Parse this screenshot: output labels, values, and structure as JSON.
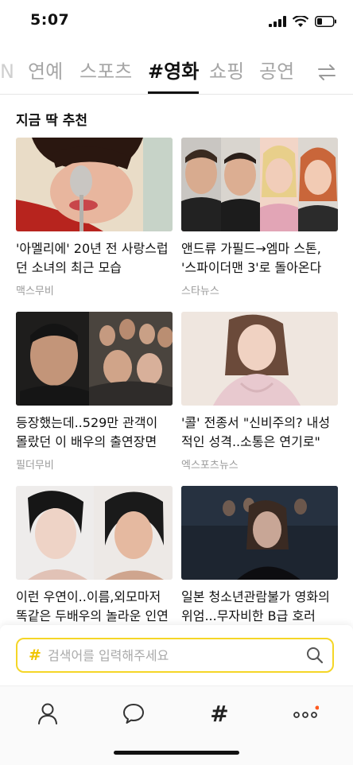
{
  "status_bar": {
    "time": "5:07"
  },
  "tabs": [
    {
      "label": "N"
    },
    {
      "label": "연예"
    },
    {
      "label": "스포츠"
    },
    {
      "label": "#영화",
      "active": true
    },
    {
      "label": "쇼핑"
    },
    {
      "label": "공연"
    }
  ],
  "section": {
    "title": "지금 딱 추천"
  },
  "cards": [
    {
      "title": "'아멜리에' 20년 전 사랑스럽던 소녀의 최근 모습",
      "source": "맥스무비"
    },
    {
      "title": "앤드류 가필드→엠마 스톤, '스파이더맨 3'로 돌아온다",
      "source": "스타뉴스"
    },
    {
      "title": "등장했는데..529만 관객이 몰랐던 이 배우의 출연장면",
      "source": "필더무비"
    },
    {
      "title": "'콜' 전종서 \"신비주의? 내성적인 성격..소통은 연기로\"",
      "source": "엑스포츠뉴스"
    },
    {
      "title": "이런 우연이..이름,외모마저 똑같은 두배우의 놀라운 인연",
      "source": ""
    },
    {
      "title": "일본 청소년관람불가 영화의 위엄...무자비한 B급 호러",
      "source": ""
    }
  ],
  "search": {
    "hash": "#",
    "placeholder": "검색어를 입력해주세요"
  },
  "bottom_nav": [
    {
      "icon": "person-icon"
    },
    {
      "icon": "chat-bubble-icon"
    },
    {
      "icon": "hashtag-icon",
      "label": "#"
    },
    {
      "icon": "more-icon",
      "badge": true
    }
  ],
  "colors": {
    "accent": "#f5d627",
    "badge": "#ff5a1f"
  }
}
